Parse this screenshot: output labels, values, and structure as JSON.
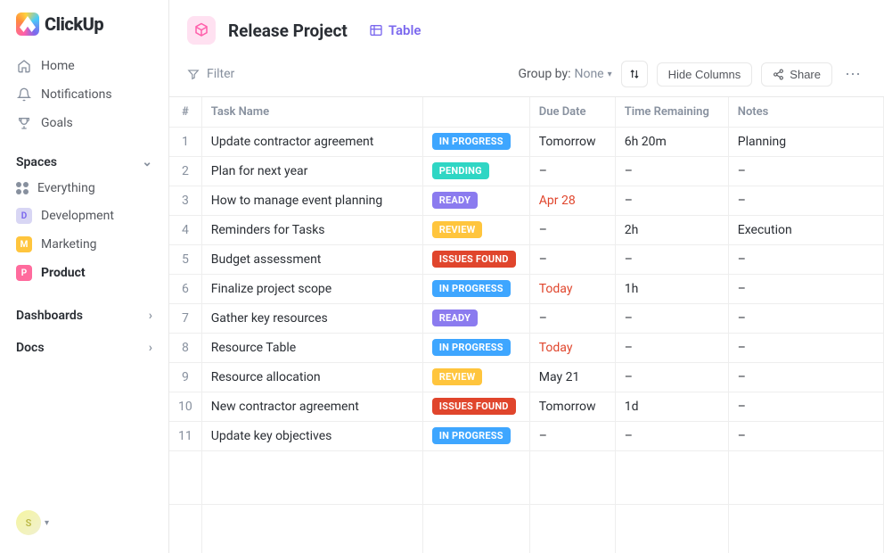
{
  "brand": "ClickUp",
  "sidebar": {
    "nav": [
      {
        "label": "Home"
      },
      {
        "label": "Notifications"
      },
      {
        "label": "Goals"
      }
    ],
    "spaces_header": "Spaces",
    "everything": "Everything",
    "spaces": [
      {
        "letter": "D",
        "label": "Development"
      },
      {
        "letter": "M",
        "label": "Marketing"
      },
      {
        "letter": "P",
        "label": "Product"
      }
    ],
    "dashboards": "Dashboards",
    "docs": "Docs",
    "avatar_initial": "S"
  },
  "header": {
    "project_title": "Release Project",
    "view_label": "Table"
  },
  "toolbar": {
    "filter": "Filter",
    "groupby_label": "Group by:",
    "groupby_value": "None",
    "hide_columns": "Hide Columns",
    "share": "Share"
  },
  "table": {
    "columns": {
      "num": "#",
      "name": "Task Name",
      "status": "",
      "due": "Due Date",
      "time": "Time Remaining",
      "notes": "Notes"
    },
    "rows": [
      {
        "num": "1",
        "name": "Update contractor agreement",
        "status": "IN PROGRESS",
        "status_class": "st-inprogress",
        "due": "Tomorrow",
        "due_urgent": false,
        "time": "6h 20m",
        "notes": "Planning"
      },
      {
        "num": "2",
        "name": "Plan for next year",
        "status": "PENDING",
        "status_class": "st-pending",
        "due": "–",
        "due_urgent": false,
        "time": "–",
        "notes": "–"
      },
      {
        "num": "3",
        "name": "How to manage event planning",
        "status": "READY",
        "status_class": "st-ready",
        "due": "Apr 28",
        "due_urgent": true,
        "time": "–",
        "notes": "–"
      },
      {
        "num": "4",
        "name": "Reminders for Tasks",
        "status": "REVIEW",
        "status_class": "st-review",
        "due": "–",
        "due_urgent": false,
        "time": "2h",
        "notes": "Execution"
      },
      {
        "num": "5",
        "name": "Budget assessment",
        "status": "ISSUES FOUND",
        "status_class": "st-issues",
        "due": "–",
        "due_urgent": false,
        "time": "–",
        "notes": "–"
      },
      {
        "num": "6",
        "name": "Finalize project  scope",
        "status": "IN PROGRESS",
        "status_class": "st-inprogress",
        "due": "Today",
        "due_urgent": true,
        "time": "1h",
        "notes": "–"
      },
      {
        "num": "7",
        "name": "Gather key resources",
        "status": "READY",
        "status_class": "st-ready",
        "due": "–",
        "due_urgent": false,
        "time": "–",
        "notes": "–"
      },
      {
        "num": "8",
        "name": "Resource Table",
        "status": "IN PROGRESS",
        "status_class": "st-inprogress",
        "due": "Today",
        "due_urgent": true,
        "time": "–",
        "notes": "–"
      },
      {
        "num": "9",
        "name": "Resource allocation",
        "status": "REVIEW",
        "status_class": "st-review",
        "due": "May 21",
        "due_urgent": false,
        "time": "–",
        "notes": "–"
      },
      {
        "num": "10",
        "name": "New contractor agreement",
        "status": "ISSUES FOUND",
        "status_class": "st-issues",
        "due": "Tomorrow",
        "due_urgent": false,
        "time": "1d",
        "notes": "–"
      },
      {
        "num": "11",
        "name": "Update key objectives",
        "status": "IN PROGRESS",
        "status_class": "st-inprogress",
        "due": "–",
        "due_urgent": false,
        "time": "–",
        "notes": "–"
      }
    ]
  }
}
